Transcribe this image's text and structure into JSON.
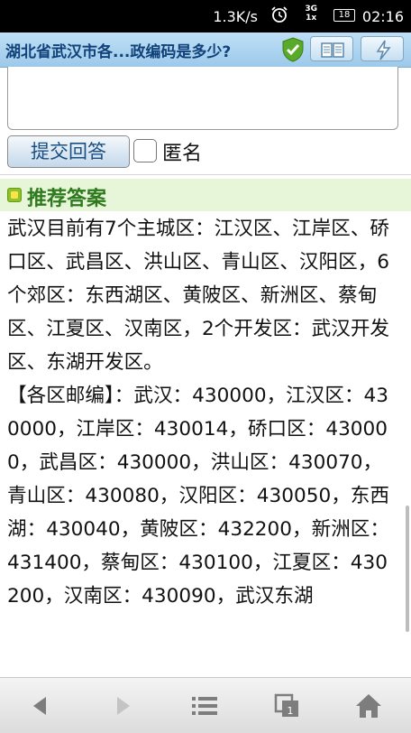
{
  "status_bar": {
    "network_speed": "1.3K/s",
    "signal_labels": [
      "3G",
      "1x"
    ],
    "battery": "18",
    "time": "02:16"
  },
  "browser": {
    "page_title": "湖北省武汉市各...政编码是多少?"
  },
  "form": {
    "submit_label": "提交回答",
    "anonymous_label": "匿名"
  },
  "recommended": {
    "header": "推荐答案",
    "paragraphs": [
      "武汉目前有7个主城区：江汉区、江岸区、硚口区、武昌区、洪山区、青山区、汉阳区，6个郊区：东西湖区、黄陂区、新洲区、蔡甸区、江夏区、汉南区，2个开发区：武汉开发区、东湖开发区。",
      "【各区邮编】：武汉：430000，江汉区：430000，江岸区：430014，硚口区：430000，武昌区：430000，洪山区：430070，青山区：430080，汉阳区：430050，东西湖：430040，黄陂区：432200，新洲区：431400，蔡甸区：430100，江夏区：430200，汉南区：430090，武汉东湖"
    ]
  },
  "colors": {
    "title_text": "#11427a",
    "recommended_bg": "#e7f5d8",
    "recommended_text": "#2f7a1e"
  }
}
